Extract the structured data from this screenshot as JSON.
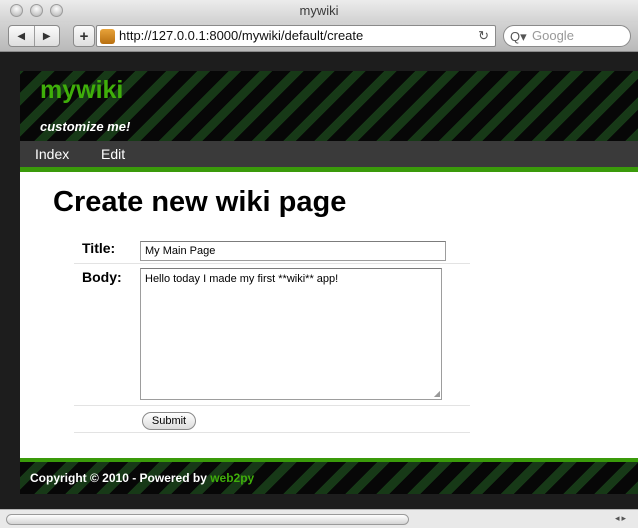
{
  "browser": {
    "window_title": "mywiki",
    "url": "http://127.0.0.1:8000/mywiki/default/create",
    "search_placeholder": "Google",
    "nav_back_glyph": "◀",
    "nav_forward_glyph": "▶",
    "add_glyph": "+",
    "reload_glyph": "↻",
    "search_icon_glyph": "Q▾"
  },
  "site": {
    "logo": "mywiki",
    "tagline": "customize me!",
    "menu": [
      "Index",
      "Edit"
    ],
    "brand_color": "#3fae0a"
  },
  "page": {
    "title": "Create new wiki page",
    "form": {
      "title_label": "Title:",
      "title_value": "My Main Page",
      "body_label": "Body:",
      "body_value": "Hello today I made my first **wiki** app!",
      "submit_label": "Submit"
    }
  },
  "footer": {
    "copyright_text": "Copyright © 2010 - Powered by ",
    "powered_link": "web2py"
  },
  "scrollbar": {
    "arrows": "◂▸"
  }
}
